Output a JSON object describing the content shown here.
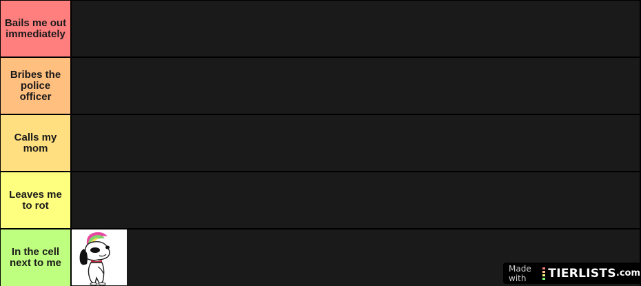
{
  "tiers": [
    {
      "label": "Bails me out immediately",
      "color": "#ff7f7f"
    },
    {
      "label": "Bribes the police officer",
      "color": "#ffbf7f"
    },
    {
      "label": "Calls my mom",
      "color": "#ffdf7f"
    },
    {
      "label": "Leaves me to rot",
      "color": "#ffff7f"
    },
    {
      "label": "In the cell next to me",
      "color": "#bfff7f"
    }
  ],
  "items": [
    {
      "tier": 4,
      "icon": "snoopy-punk-image"
    }
  ],
  "watermark": {
    "made_with": "Made with",
    "brand": "TIERLISTS",
    "domain": ".com"
  },
  "colors": {
    "row_background": "#1a1a1a",
    "border": "#000000"
  }
}
